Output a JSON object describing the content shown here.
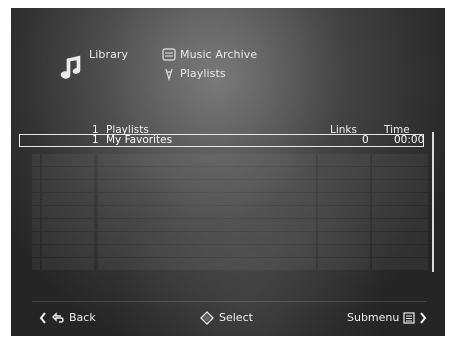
{
  "header": {
    "library": "Library",
    "music_archive": "Music Archive",
    "playlists": "Playlists"
  },
  "table": {
    "columns": [
      "1",
      "Playlists",
      "Links",
      "Time"
    ],
    "selected_row": {
      "index": "1",
      "name": "My Favorites",
      "links": "0",
      "time": "00:00"
    }
  },
  "footer": {
    "back": "Back",
    "select": "Select",
    "submenu": "Submenu"
  }
}
